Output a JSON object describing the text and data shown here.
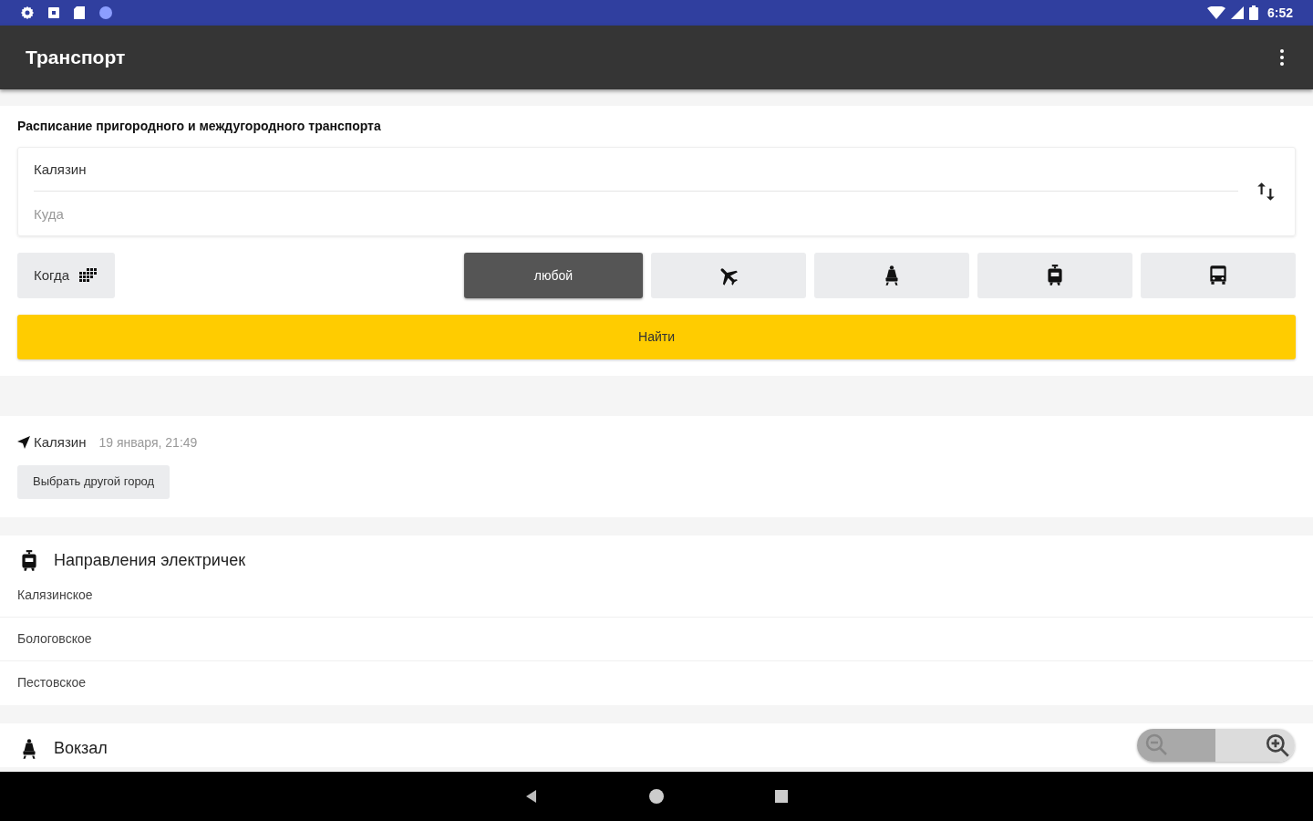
{
  "status_bar": {
    "time": "6:52"
  },
  "app_bar": {
    "title": "Транспорт"
  },
  "search": {
    "title": "Расписание пригородного и междугородного транспорта",
    "from": {
      "value": "Калязин"
    },
    "to": {
      "placeholder": "Куда"
    },
    "when_button": "Когда",
    "modes": [
      {
        "kind": "any",
        "label": "любой",
        "selected": true
      },
      {
        "kind": "plane",
        "selected": false
      },
      {
        "kind": "train",
        "selected": false
      },
      {
        "kind": "suburban",
        "selected": false
      },
      {
        "kind": "bus",
        "selected": false
      }
    ],
    "find_button": "Найти"
  },
  "location": {
    "city": "Калязин",
    "date": "19 января, 21:49",
    "change_button": "Выбрать другой город"
  },
  "sections": [
    {
      "kind": "suburban",
      "title": "Направления электричек",
      "items": [
        "Калязинское",
        "Бологовское",
        "Пестовское"
      ]
    },
    {
      "kind": "train",
      "title": "Вокзал"
    }
  ]
}
